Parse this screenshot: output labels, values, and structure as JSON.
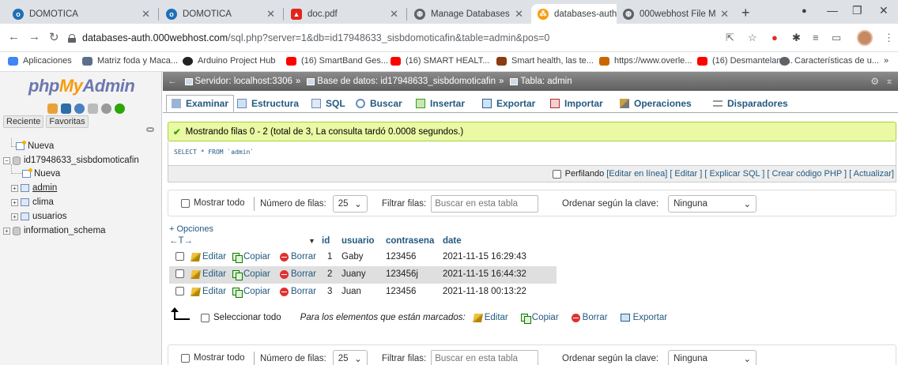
{
  "browser": {
    "tabs": [
      {
        "title": "DOMOTICA",
        "icon": "site-favicon-icon"
      },
      {
        "title": "DOMOTICA",
        "icon": "site-favicon-icon"
      },
      {
        "title": "doc.pdf",
        "icon": "pdf-icon"
      },
      {
        "title": "Manage Databases",
        "icon": "globe-icon"
      },
      {
        "title": "databases-auth.000we",
        "icon": "phpmyadmin-icon"
      },
      {
        "title": "000webhost File Mana",
        "icon": "globe-icon"
      }
    ],
    "active_tab": 4,
    "url_host": "databases-auth.000webhost.com",
    "url_path": "/sql.php?server=1&db=id17948633_sisbdomoticafin&table=admin&pos=0",
    "bookmarks": [
      {
        "label": "Aplicaciones",
        "color": "#4285f4"
      },
      {
        "label": "Matriz foda y Maca...",
        "color": "#5b6f8c"
      },
      {
        "label": "Arduino Project Hub",
        "color": "#222222"
      },
      {
        "label": "(16) SmartBand Ges...",
        "color": "#ff0000"
      },
      {
        "label": "(16) SMART HEALT...",
        "color": "#ff0000"
      },
      {
        "label": "Smart health, las te...",
        "color": "#8a3b12"
      },
      {
        "label": "https://www.overle...",
        "color": "#cc6600"
      },
      {
        "label": "(16) Desmantelami...",
        "color": "#ff0000"
      },
      {
        "label": "Características de u...",
        "color": "#5f6368"
      }
    ],
    "bookmarks_more": "»"
  },
  "nav": {
    "logo_php": "php",
    "logo_my": "My",
    "logo_admin": "Admin",
    "tab_recent": "Reciente",
    "tab_favorites": "Favoritas",
    "tree": {
      "new_root": "Nueva",
      "db": "id17948633_sisbdomoticafin",
      "new_table": "Nueva",
      "tables": [
        "admin",
        "clima",
        "usuarios"
      ],
      "info_schema": "information_schema"
    }
  },
  "breadcrumb": {
    "server": "Servidor: localhost:3306",
    "database": "Base de datos: id17948633_sisbdomoticafin",
    "table": "Tabla: admin",
    "separator": "»"
  },
  "menu": [
    "Examinar",
    "Estructura",
    "SQL",
    "Buscar",
    "Insertar",
    "Exportar",
    "Importar",
    "Operaciones",
    "Disparadores"
  ],
  "success_message": "Mostrando filas 0 - 2 (total de 3, La consulta tardó 0.0008 segundos.)",
  "sql_query": "SELECT * FROM `admin`",
  "profile": {
    "label": "Perfilando",
    "links": "[Editar en línea] [ Editar ] [ Explicar SQL ] [ Crear código PHP ] [ Actualizar]"
  },
  "navbar": {
    "show_all": "Mostrar todo",
    "rows_label": "Número de filas:",
    "rows_value": "25",
    "filter_label": "Filtrar filas:",
    "filter_placeholder": "Buscar en esta tabla",
    "sort_label": "Ordenar según la clave:",
    "sort_value": "Ninguna"
  },
  "options_link": "+ Opciones",
  "table": {
    "nav_arrows": "←T→",
    "sort_arrow": "▼",
    "headers": [
      "id",
      "usuario",
      "contrasena",
      "date"
    ],
    "actions": {
      "edit": "Editar",
      "copy": "Copiar",
      "delete": "Borrar"
    },
    "rows": [
      {
        "id": "1",
        "usuario": "Gaby",
        "contrasena": "123456",
        "date": "2021-11-15 16:29:43"
      },
      {
        "id": "2",
        "usuario": "Juany",
        "contrasena": "123456j",
        "date": "2021-11-15 16:44:32"
      },
      {
        "id": "3",
        "usuario": "Juan",
        "contrasena": "123456",
        "date": "2021-11-18 00:13:22"
      }
    ]
  },
  "mass": {
    "select_all": "Seleccionar todo",
    "with_selected": "Para los elementos que están marcados:",
    "edit": "Editar",
    "copy": "Copiar",
    "delete": "Borrar",
    "export": "Exportar"
  },
  "colors": {
    "link": "#235a81",
    "success_bg": "#ebf8a4",
    "row_alt": "#dfdfdf"
  }
}
